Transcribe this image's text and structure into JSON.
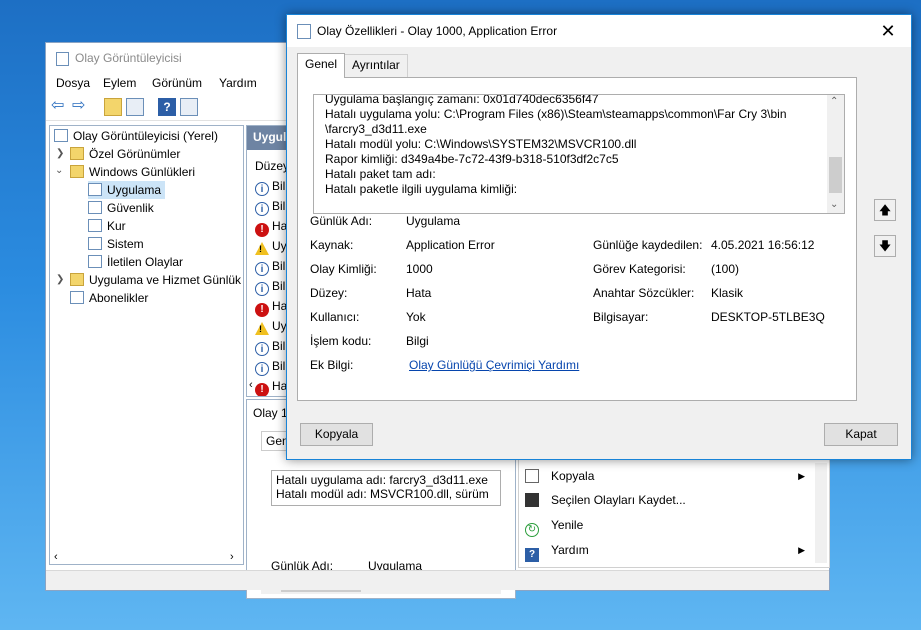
{
  "event_viewer": {
    "title": "Olay Görüntüleyicisi",
    "menu": [
      "Dosya",
      "Eylem",
      "Görünüm",
      "Yardım"
    ],
    "tree": {
      "root": "Olay Görüntüleyicisi (Yerel)",
      "custom_views": "Özel Görünümler",
      "windows_logs": "Windows Günlükleri",
      "logs": [
        "Uygulama",
        "Güvenlik",
        "Kur",
        "Sistem",
        "İletilen Olaylar"
      ],
      "app_services": "Uygulama ve Hizmet Günlük",
      "subscriptions": "Abonelikler"
    },
    "mid_header": "Uygula",
    "mid_col": "Düzey",
    "rows": [
      {
        "type": "info",
        "text": "Bil"
      },
      {
        "type": "info",
        "text": "Bil"
      },
      {
        "type": "err",
        "text": "Ha"
      },
      {
        "type": "warn",
        "text": "Uy"
      },
      {
        "type": "info",
        "text": "Bil"
      },
      {
        "type": "info",
        "text": "Bil"
      },
      {
        "type": "err",
        "text": "Ha"
      },
      {
        "type": "warn",
        "text": "Uy"
      },
      {
        "type": "info",
        "text": "Bil"
      },
      {
        "type": "info",
        "text": "Bil"
      },
      {
        "type": "err",
        "text": "Ha"
      }
    ],
    "lower_header": "Olay 1",
    "lower_tab": "Gen",
    "lower_desc": "Hatalı uygulama adı: farcry3_d3d11.exe\nHatalı modül adı: MSVCR100.dll, sürüm",
    "lower_log_label": "Günlük Adı:",
    "lower_log_value": "Uygulama",
    "actions": [
      {
        "label": "Kopyala",
        "icon": "copy-icon",
        "arrow": true
      },
      {
        "label": "Seçilen Olayları Kaydet...",
        "icon": "save-icon",
        "arrow": false
      },
      {
        "label": "Yenile",
        "icon": "refresh-icon",
        "arrow": false
      },
      {
        "label": "Yardım",
        "icon": "help-icon",
        "arrow": true
      }
    ]
  },
  "dialog": {
    "title": "Olay Özellikleri - Olay 1000, Application Error",
    "close": "✕",
    "tabs": [
      "Genel",
      "Ayrıntılar"
    ],
    "description": "Uygulama başlangıç zamanı: 0x01d740dec6356f47\nHatalı uygulama yolu: C:\\Program Files (x86)\\Steam\\steamapps\\common\\Far Cry 3\\bin\n\\farcry3_d3d11.exe\nHatalı modül yolu: C:\\Windows\\SYSTEM32\\MSVCR100.dll\nRapor kimliği: d349a4be-7c72-43f9-b318-510f3df2c7c5\nHatalı paket tam adı:\nHatalı paketle ilgili uygulama kimliği:",
    "fields": {
      "log_name_label": "Günlük Adı:",
      "log_name": "Uygulama",
      "source_label": "Kaynak:",
      "source": "Application Error",
      "logged_label": "Günlüğe kaydedilen:",
      "logged": "4.05.2021 16:56:12",
      "event_id_label": "Olay Kimliği:",
      "event_id": "1000",
      "task_label": "Görev Kategorisi:",
      "task": "(100)",
      "level_label": "Düzey:",
      "level": "Hata",
      "keywords_label": "Anahtar Sözcükler:",
      "keywords": "Klasik",
      "user_label": "Kullanıcı:",
      "user": "Yok",
      "computer_label": "Bilgisayar:",
      "computer": "DESKTOP-5TLBE3Q",
      "opcode_label": "İşlem kodu:",
      "opcode": "Bilgi",
      "more_label": "Ek Bilgi:",
      "more_link": "Olay Günlüğü Çevrimiçi Yardımı"
    },
    "copy_button": "Kopyala",
    "close_button": "Kapat"
  }
}
